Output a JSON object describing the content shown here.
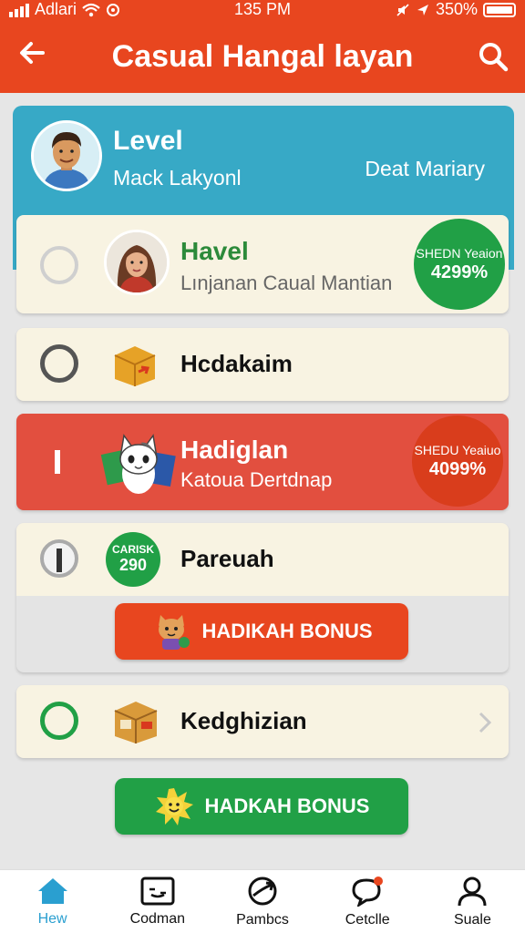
{
  "status_bar": {
    "carrier": "Adlari",
    "time": "135 PM",
    "battery": "350%"
  },
  "header": {
    "title": "Casual Hangal layan",
    "back_icon": "arrow-left-icon",
    "search_icon": "search-icon"
  },
  "profile": {
    "level_label": "Level",
    "username": "Mack Lakyonl",
    "right_label": "Deat Mariary"
  },
  "items": [
    {
      "title": "Havel",
      "subtitle": "Lınjanan Caual Mantian",
      "badge_label": "SHEDN Yeaion",
      "badge_value": "4299%"
    },
    {
      "title": "Hcdakaim"
    },
    {
      "title": "Hadiglan",
      "subtitle": "Katoua Dertdnap",
      "badge_label": "SHEDU Yeaiuo",
      "badge_value": "4099%"
    },
    {
      "title": "Pareuah",
      "icon_text_top": "CARISK",
      "icon_text_bottom": "290"
    },
    {
      "title": "Kedghizian"
    }
  ],
  "bonus_buttons": [
    {
      "label": "HADIKAH BONUS"
    },
    {
      "label": "HADKAH BONUS"
    }
  ],
  "tabs": [
    {
      "label": "Hew",
      "icon": "home-icon"
    },
    {
      "label": "Codman",
      "icon": "card-icon"
    },
    {
      "label": "Pambcs",
      "icon": "circle-arrow-icon"
    },
    {
      "label": "Cetclle",
      "icon": "chat-icon"
    },
    {
      "label": "Suale",
      "icon": "person-icon"
    }
  ],
  "colors": {
    "header": "#e8461f",
    "profile": "#37a9c6",
    "green": "#21a046",
    "red_card": "#e24f3f",
    "tab_active": "#2a9fd0"
  }
}
